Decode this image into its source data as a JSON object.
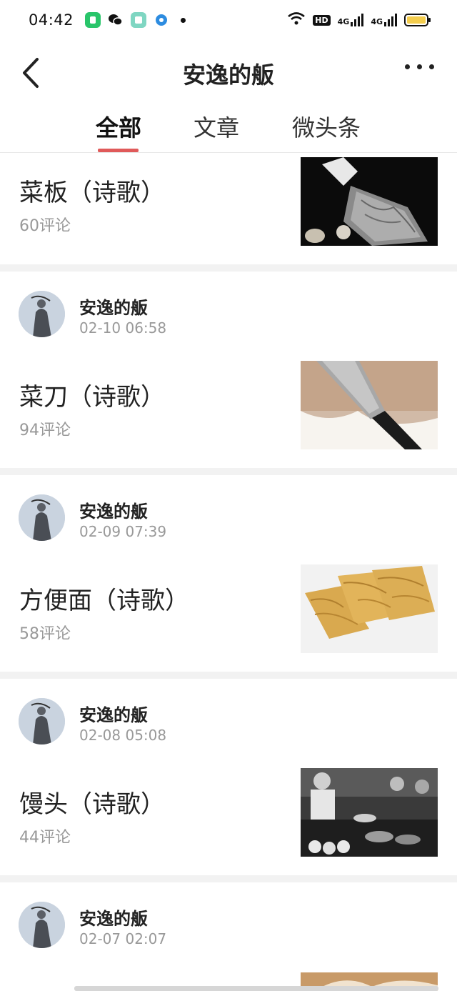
{
  "status_bar": {
    "time": "04:42",
    "hd_label": "HD",
    "net1": "4G",
    "net2": "4G"
  },
  "header": {
    "title": "安逸的舨"
  },
  "tabs": [
    {
      "label": "全部",
      "active": true
    },
    {
      "label": "文章",
      "active": false
    },
    {
      "label": "微头条",
      "active": false
    }
  ],
  "feed": [
    {
      "author": "",
      "date": "",
      "title": "菜板（诗歌）",
      "comments": "60评论",
      "thumb": "cleaver-on-board-photo"
    },
    {
      "author": "安逸的舨",
      "date": "02-10 06:58",
      "title": "菜刀（诗歌）",
      "comments": "94评论",
      "thumb": "kitchen-knife-photo"
    },
    {
      "author": "安逸的舨",
      "date": "02-09 07:39",
      "title": "方便面（诗歌）",
      "comments": "58评论",
      "thumb": "instant-noodles-photo"
    },
    {
      "author": "安逸的舨",
      "date": "02-08 05:08",
      "title": "馒头（诗歌）",
      "comments": "44评论",
      "thumb": "steamed-buns-photo"
    },
    {
      "author": "安逸的舨",
      "date": "02-07 02:07",
      "title": "",
      "comments": "",
      "thumb": "partial-photo"
    }
  ],
  "colors": {
    "accent": "#e05a5a",
    "meta": "#999999"
  }
}
